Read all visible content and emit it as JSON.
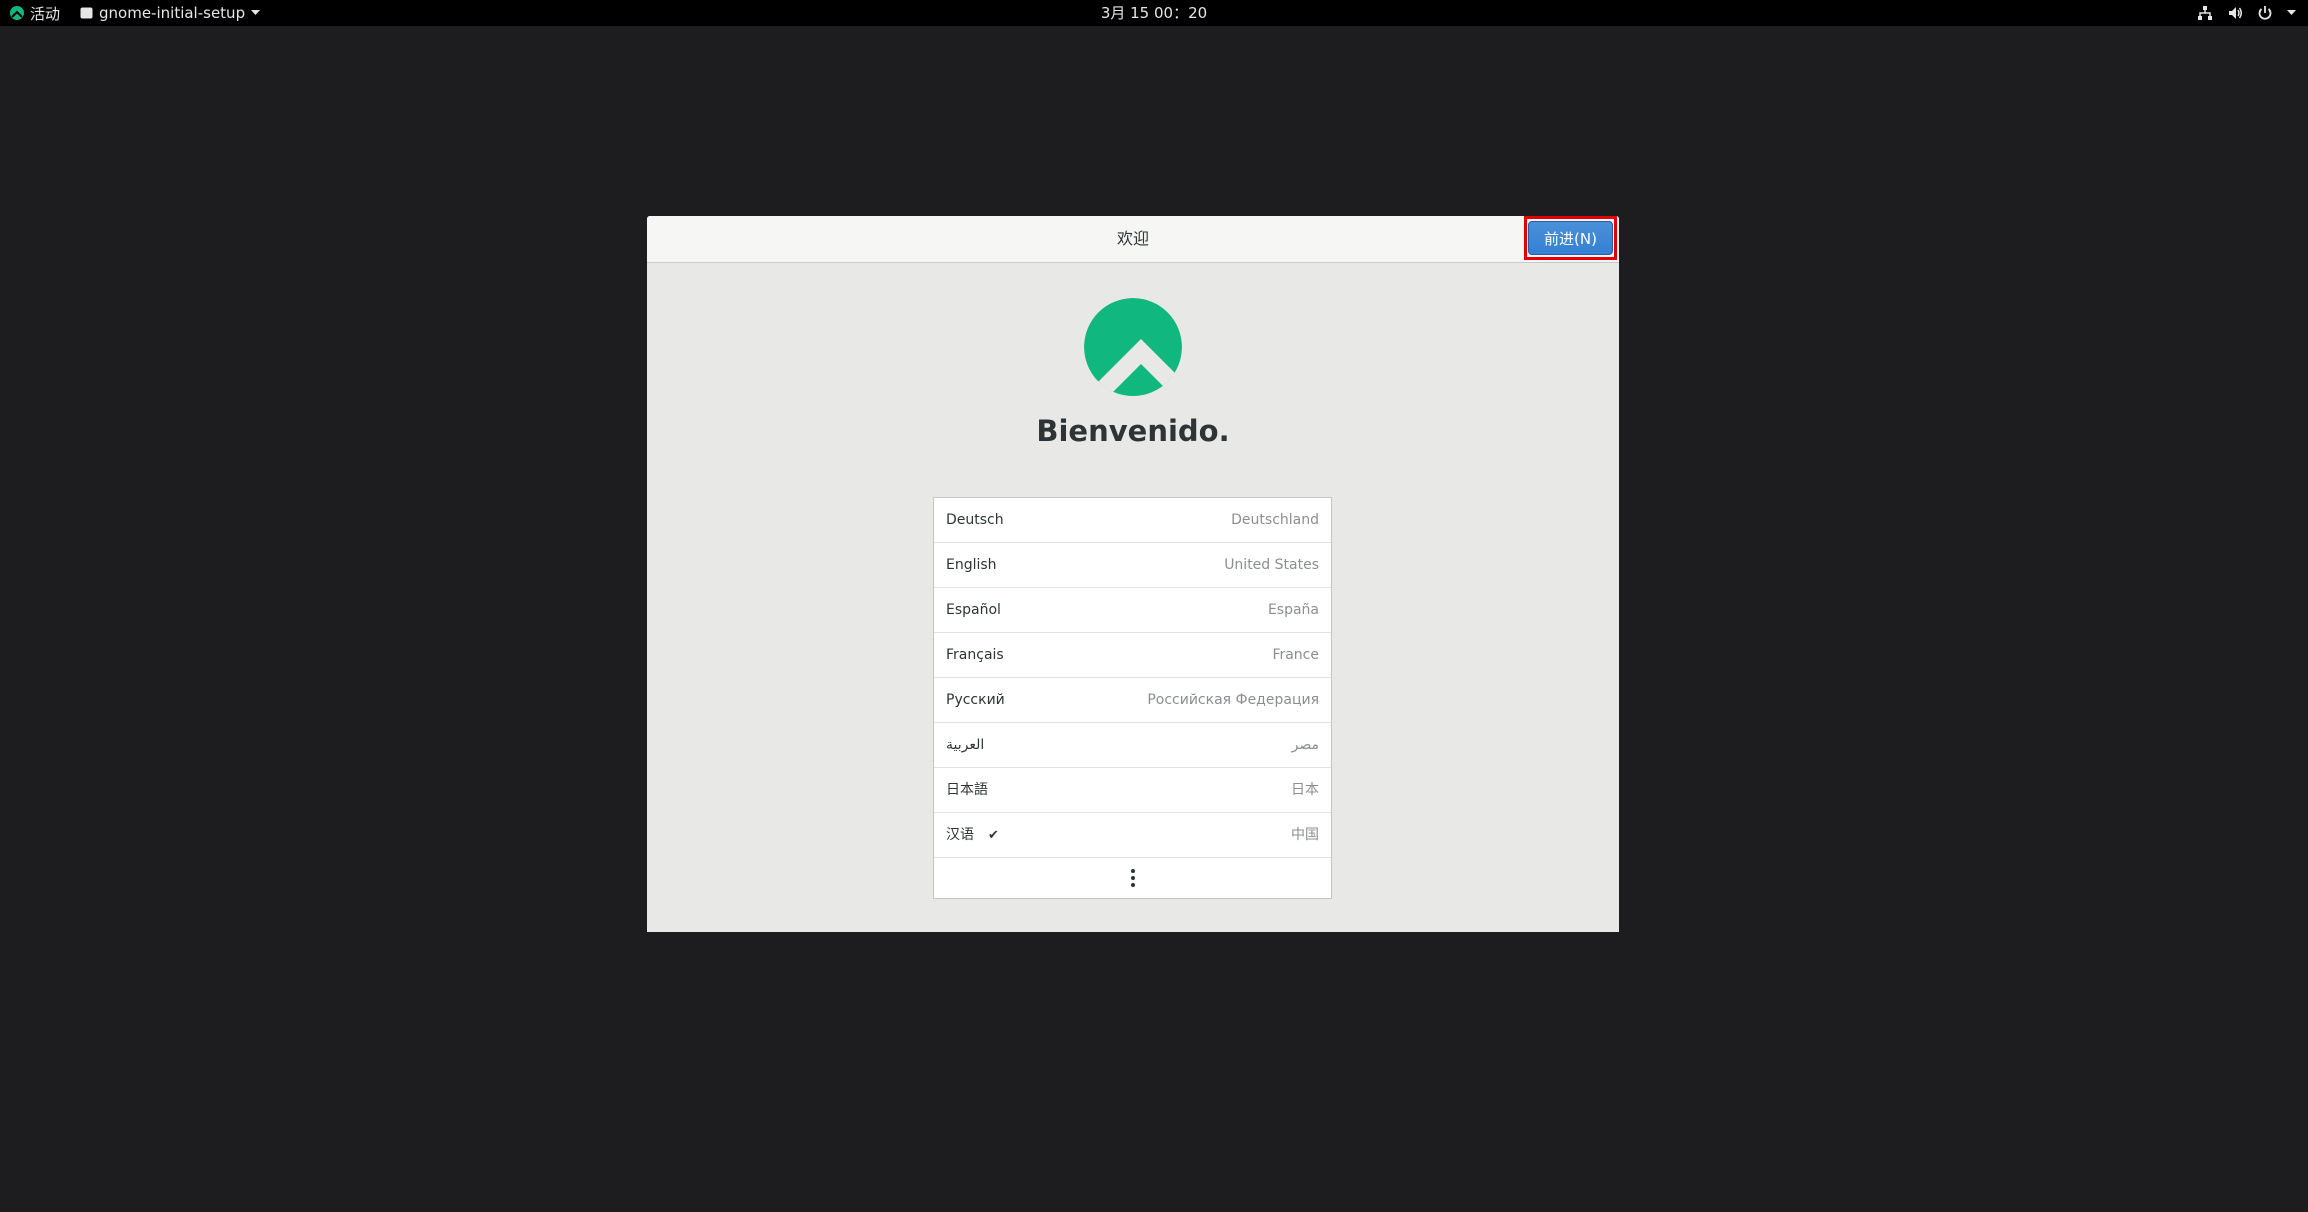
{
  "topbar": {
    "activities_label": "活动",
    "app_menu_label": "gnome-initial-setup",
    "clock": "3月 15  00：20",
    "icons": [
      "network-icon",
      "volume-icon",
      "power-icon",
      "chevron-down-icon"
    ]
  },
  "dialog": {
    "title": "欢迎",
    "next_button_label": "前进(N)",
    "welcome_text": "Bienvenido.",
    "logo_color": "#10b77f",
    "highlight_color": "#e40000",
    "accent_color": "#3580d4"
  },
  "languages": [
    {
      "name": "Deutsch",
      "region": "Deutschland",
      "selected": false
    },
    {
      "name": "English",
      "region": "United States",
      "selected": false
    },
    {
      "name": "Español",
      "region": "España",
      "selected": false
    },
    {
      "name": "Français",
      "region": "France",
      "selected": false
    },
    {
      "name": "Русский",
      "region": "Российская Федерация",
      "selected": false
    },
    {
      "name": "العربية",
      "region": "مصر",
      "selected": false
    },
    {
      "name": "日本語",
      "region": "日本",
      "selected": false
    },
    {
      "name": "汉语",
      "region": "中国",
      "selected": true
    }
  ],
  "selected_mark": "✔"
}
